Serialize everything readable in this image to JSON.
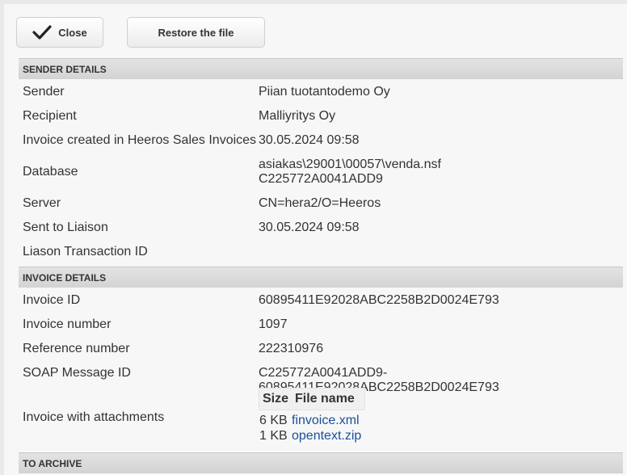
{
  "toolbar": {
    "close_label": "Close",
    "restore_label": "Restore the file"
  },
  "sender_section": {
    "title": "SENDER DETAILS",
    "rows": [
      {
        "label": "Sender",
        "value": "Piian tuotantodemo Oy"
      },
      {
        "label": "Recipient",
        "value": "Malliyritys Oy"
      },
      {
        "label": "Invoice created in Heeros Sales Invoices",
        "value": "30.05.2024 09:58"
      },
      {
        "label": "Database",
        "value_line1": "asiakas\\29001\\00057\\venda.nsf",
        "value_line2": "C225772A0041ADD9"
      },
      {
        "label": "Server",
        "value": "CN=hera2/O=Heeros"
      },
      {
        "label": "Sent to Liaison",
        "value": "30.05.2024 09:58"
      },
      {
        "label": "Liason Transaction ID",
        "value": ""
      }
    ]
  },
  "invoice_section": {
    "title": "INVOICE DETAILS",
    "rows": [
      {
        "label": "Invoice ID",
        "value": "60895411E92028ABC2258B2D0024E793"
      },
      {
        "label": "Invoice number",
        "value": "1097"
      },
      {
        "label": "Reference number",
        "value": "222310976"
      },
      {
        "label": "SOAP Message ID",
        "value": "C225772A0041ADD9-60895411E92028ABC2258B2D0024E793"
      },
      {
        "label": "Invoice with attachments"
      }
    ],
    "attachments": {
      "headers": {
        "size": "Size",
        "name": "File name"
      },
      "files": [
        {
          "size": "6 KB",
          "name": "finvoice.xml"
        },
        {
          "size": "1 KB",
          "name": "opentext.zip"
        }
      ]
    }
  },
  "archive_section": {
    "title": "TO ARCHIVE"
  },
  "icons": {
    "close_button_icon": "checkmark-icon"
  }
}
